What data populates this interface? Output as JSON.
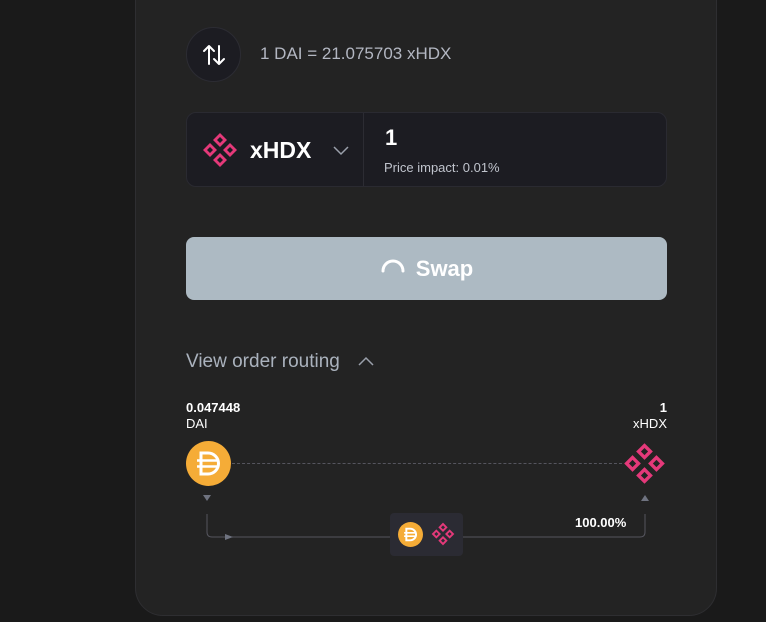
{
  "swap": {
    "rate_text": "1 DAI = 21.075703 xHDX",
    "asset": {
      "symbol": "xHDX",
      "logo_icon": "hydradx-logo-icon"
    },
    "amount": "1",
    "price_impact": "Price impact: 0.01%",
    "button_label": "Swap",
    "button_state_icon": "loading-spinner-icon"
  },
  "routing": {
    "toggle_label": "View order routing",
    "source": {
      "amount": "0.047448",
      "symbol": "DAI",
      "icon": "dai-logo-icon"
    },
    "destination": {
      "amount": "1",
      "symbol": "xHDX",
      "icon": "hydradx-logo-icon"
    },
    "route_share": "100.00%"
  },
  "colors": {
    "background": "#1a1a1a",
    "card": "#232323",
    "input_bg": "#1c1c22",
    "swap_button": "#adbac3",
    "hdx_pink": "#e5397a",
    "dai_yellow": "#f5ac37"
  }
}
